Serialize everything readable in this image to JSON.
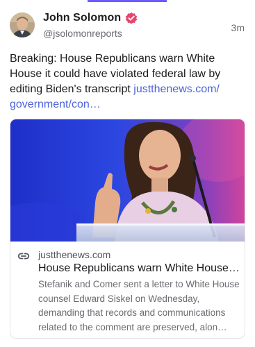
{
  "post": {
    "author_name": "John Solomon",
    "handle": "@jsolomonreports",
    "time": "3m",
    "text": "Breaking: House Republicans warn White House it could have violated federal law by editing Biden's transcript ",
    "link_text": "justthenews.com/ government/con…"
  },
  "link_card": {
    "domain": "justthenews.com",
    "title": "House Republicans warn White House…",
    "description": "Stefanik and Comer sent a letter to White House counsel Edward Siskel on Wednesday, demanding that records and communications related to the comment are preserved, alon…"
  },
  "icons": {
    "verified": "verified-badge-icon",
    "link": "link-chain-icon"
  },
  "colors": {
    "link": "#4d63d9",
    "verified_badge": "#e8466e",
    "accent_tab": "#6a5cff"
  }
}
